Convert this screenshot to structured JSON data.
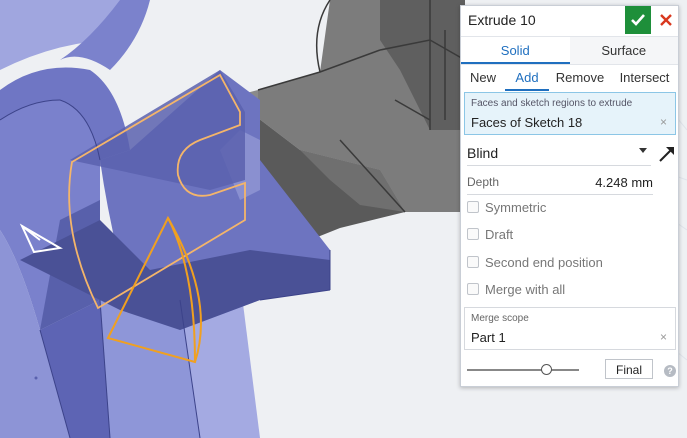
{
  "panel": {
    "title": "Extrude 10",
    "accept_icon": "checkmark-icon",
    "cancel_icon": "close-icon",
    "body_types": [
      "Solid",
      "Surface"
    ],
    "body_type_selected": "Solid",
    "operations": [
      "New",
      "Add",
      "Remove",
      "Intersect"
    ],
    "operation_selected": "Add",
    "selection": {
      "caption": "Faces and sketch regions to extrude",
      "value": "Faces of Sketch 18",
      "clear": "×"
    },
    "end_type": "Blind",
    "depth": {
      "label": "Depth",
      "value": "4.248 mm"
    },
    "checkboxes": [
      "Symmetric",
      "Draft",
      "Second end position",
      "Merge with all"
    ],
    "merge_scope": {
      "caption": "Merge scope",
      "value": "Part 1",
      "clear": "×"
    },
    "final_button": "Final",
    "help": "?"
  },
  "colors": {
    "part_blue": "#8e96d8",
    "part_dark": "#4a5196",
    "gray_part": "#6a6a6a",
    "sketch_orange": "#f0a020",
    "accent": "#1f6fbf",
    "accept_green": "#1e8f3a",
    "cancel_red": "#d9381e"
  }
}
